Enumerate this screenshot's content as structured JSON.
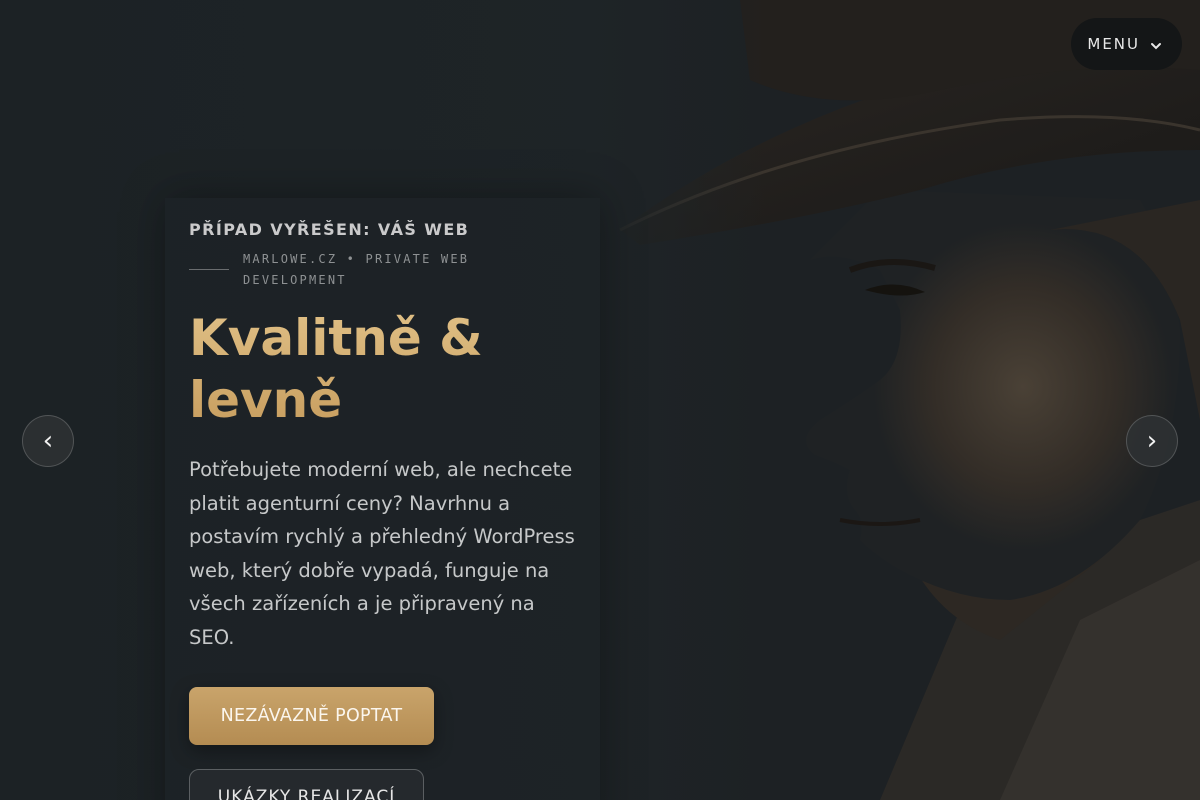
{
  "header": {
    "menu_label": "MENU",
    "menu_icon": "chevron-down-icon"
  },
  "carousel": {
    "prev_label": "‹",
    "next_label": "›"
  },
  "hero": {
    "eyebrow": "PŘÍPAD VYŘEŠEN: VÁŠ WEB",
    "meta": "MARLOWE.CZ • PRIVATE WEB DEVELOPMENT",
    "headline": "Kvalitně & levně",
    "description": "Potřebujete moderní web, ale nechcete platit agenturní ceny? Navrhnu a postavím rychlý a přehledný WordPress web, který dobře vypadá, funguje na všech zařízeních a je připravený na SEO.",
    "primary_button": "NEZÁVAZNĚ POPTAT",
    "secondary_button": "UKÁZKY REALIZACÍ"
  },
  "colors": {
    "accent_gold": "#c9a46b",
    "background": "#1c2124"
  }
}
